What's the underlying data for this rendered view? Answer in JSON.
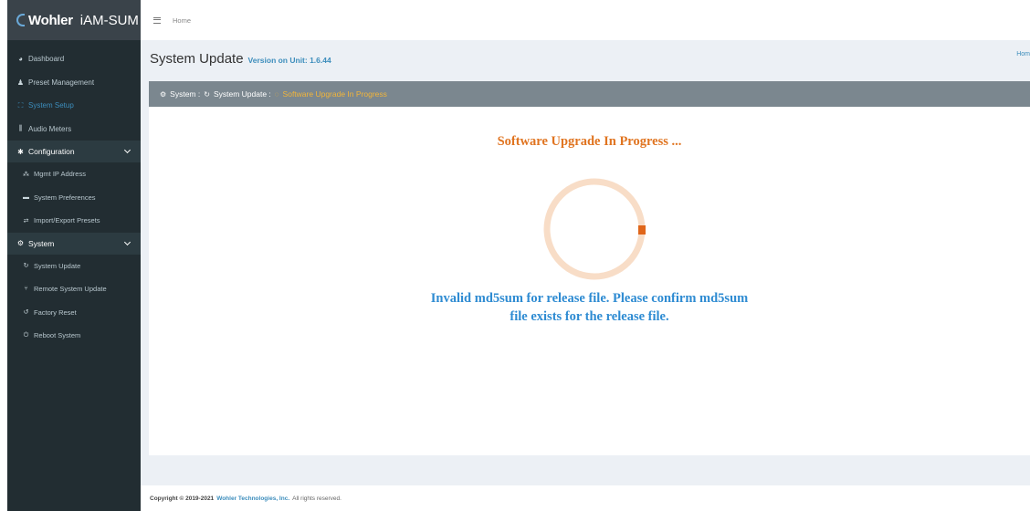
{
  "brand": {
    "logo": "Wohler",
    "name": "iAM-SUM"
  },
  "sidebar": {
    "items": [
      {
        "label": "Dashboard",
        "icon": "dashboard-icon"
      },
      {
        "label": "Preset Management",
        "icon": "users-icon"
      },
      {
        "label": "System Setup",
        "icon": "sitemap-icon",
        "active": true
      },
      {
        "label": "Audio Meters",
        "icon": "bar-chart-icon"
      }
    ],
    "configuration": {
      "label": "Configuration",
      "items": [
        {
          "label": "Mgmt IP Address"
        },
        {
          "label": "System Preferences"
        },
        {
          "label": "Import/Export Presets"
        }
      ]
    },
    "system": {
      "label": "System",
      "items": [
        {
          "label": "System Update"
        },
        {
          "label": "Remote System Update"
        },
        {
          "label": "Factory Reset"
        },
        {
          "label": "Reboot System"
        }
      ]
    }
  },
  "topbar": {
    "breadcrumb": "Home"
  },
  "page": {
    "title": "System Update",
    "subtitle": "Version on Unit: 1.6.44",
    "home_link": "Hom"
  },
  "panel": {
    "crumb_system": "System :",
    "crumb_update": "System Update :",
    "crumb_current": "Software Upgrade In Progress",
    "progress_title": "Software Upgrade In Progress ...",
    "error_line1": "Invalid md5sum for release file. Please confirm md5sum",
    "error_line2": "file exists for the release file."
  },
  "footer": {
    "copyright": "Copyright © 2019-2021",
    "company": "Wohler Technologies, Inc.",
    "rights": "All rights reserved."
  },
  "colors": {
    "sidebar_bg": "#222d32",
    "accent_blue": "#3c8dbc",
    "progress_orange": "#e07420",
    "error_blue": "#2e8bd2",
    "panel_header": "#7b878f"
  }
}
